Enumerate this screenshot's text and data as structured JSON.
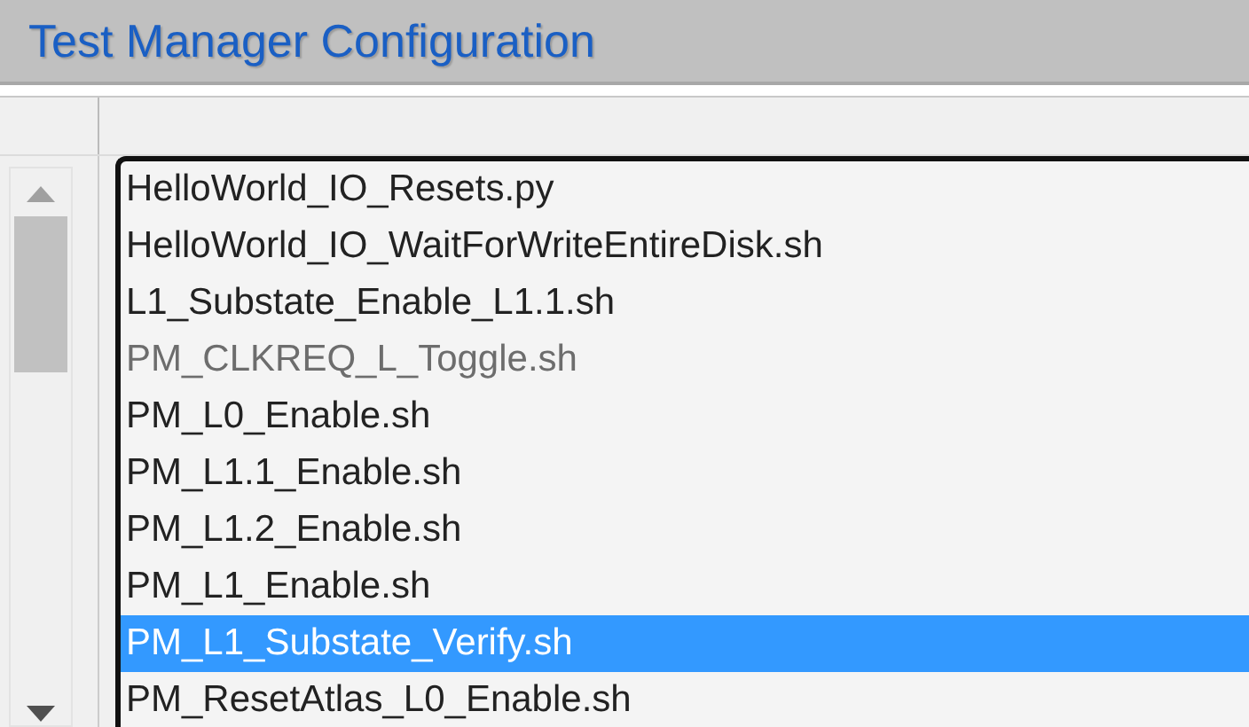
{
  "window": {
    "title": "Test Manager Configuration"
  },
  "scripts": [
    {
      "label": "HelloWorld_IO_Resets.py",
      "disabled": false,
      "selected": false
    },
    {
      "label": "HelloWorld_IO_WaitForWriteEntireDisk.sh",
      "disabled": false,
      "selected": false
    },
    {
      "label": "L1_Substate_Enable_L1.1.sh",
      "disabled": false,
      "selected": false
    },
    {
      "label": "PM_CLKREQ_L_Toggle.sh",
      "disabled": true,
      "selected": false
    },
    {
      "label": "PM_L0_Enable.sh",
      "disabled": false,
      "selected": false
    },
    {
      "label": "PM_L1.1_Enable.sh",
      "disabled": false,
      "selected": false
    },
    {
      "label": "PM_L1.2_Enable.sh",
      "disabled": false,
      "selected": false
    },
    {
      "label": "PM_L1_Enable.sh",
      "disabled": false,
      "selected": false
    },
    {
      "label": "PM_L1_Substate_Verify.sh",
      "disabled": false,
      "selected": true
    },
    {
      "label": "PM_ResetAtlas_L0_Enable.sh",
      "disabled": false,
      "selected": false
    }
  ]
}
